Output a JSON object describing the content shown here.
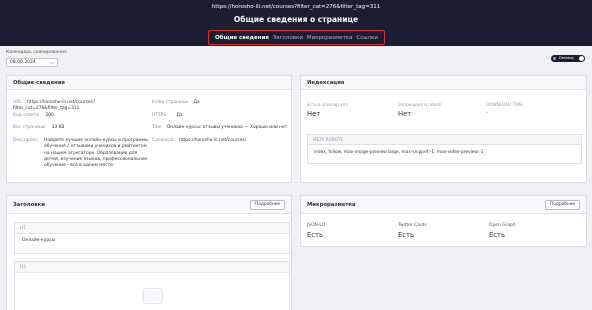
{
  "header": {
    "url": "https://horosho-ili.net/courses?filter_cat=276&filter_tag=311",
    "title": "Общие сведения о странице"
  },
  "tabs": [
    {
      "label": "Общие сведения",
      "active": true
    },
    {
      "label": "Заголовки",
      "active": false
    },
    {
      "label": "Микроразметка",
      "active": false
    },
    {
      "label": "Ссылки",
      "active": false
    }
  ],
  "scan": {
    "label": "Календарь сканирования",
    "date": "08.06.2024"
  },
  "device_toggle": {
    "label": "Desktop",
    "state": "on"
  },
  "general": {
    "title": "Общие сведения",
    "url_label": "URL",
    "url_value": "https://horosho-ili.net/courses?filter_cat=276&filter_tag=311",
    "code_label": "Код ответа",
    "code_value": "200",
    "weight_label": "Вес страницы",
    "weight_value": "33 KB",
    "desc_label": "Description",
    "desc_value": "Найдите лучшие онлайн-курсы и программы обучения с отзывами учеников и рейтингом на нашем агрегаторе. Образование для детей, изучение языков, профессиональное обучение - все в одном месте.",
    "index_label": "Index страницы",
    "index_value": "Да",
    "https_label": "HTTPS",
    "https_value": "Да",
    "title_label": "Title",
    "title_value": "Онлайн-курсы: отзывы учеников — Хорошо или нет",
    "canonical_label": "Canonical",
    "canonical_value": "https://horosho-ili.net/courses/"
  },
  "indexing": {
    "title": "Индексация",
    "sitemap_label": "Есть в sitemap.xml",
    "sitemap_value": "Нет",
    "robots_label": "Запрещена в robots",
    "robots_value": "Нет",
    "download_label": "DOWNLOAD TIME",
    "download_value": "-",
    "meta_label": "META ROBOTS",
    "meta_value": "index, follow, max-image-preview:large, max-snippet:-1, max-video-preview:-1"
  },
  "headings": {
    "title": "Заголовки",
    "button": "Подробнее",
    "h1_label": "H1",
    "h1_value": "Онлайн-курсы",
    "h2_label": "H2"
  },
  "markup": {
    "title": "Микроразметка",
    "button": "Подробнее",
    "cols": [
      {
        "label": "JSON-LD",
        "value": "Есть"
      },
      {
        "label": "Twitter Cards",
        "value": "Есть"
      },
      {
        "label": "Open Graph",
        "value": "Есть"
      }
    ]
  },
  "colors": {
    "header_bg": "#1b1e32",
    "highlight": "#e2292f",
    "page_bg": "#f0f1f4"
  }
}
